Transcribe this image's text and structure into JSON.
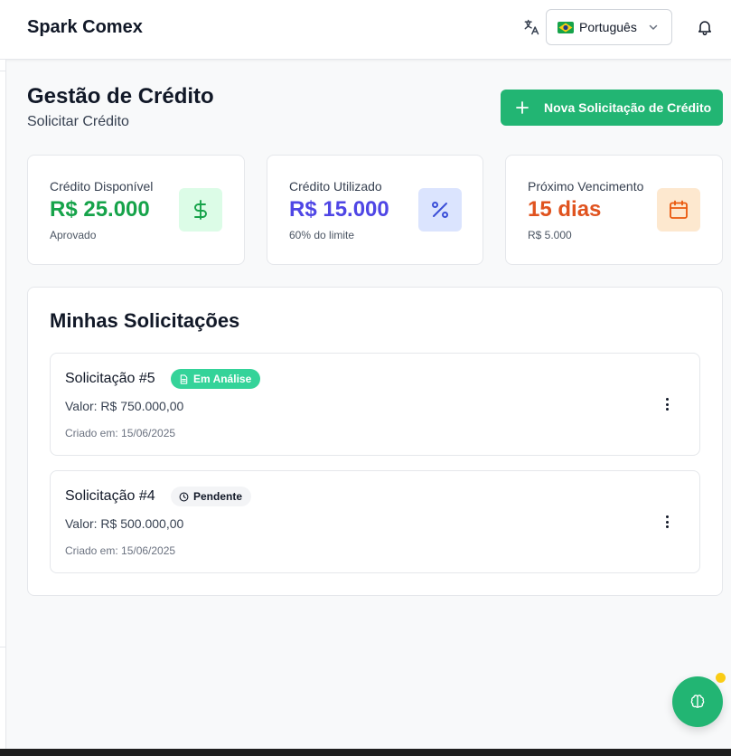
{
  "header": {
    "brand": "Spark Comex",
    "language": "Português",
    "language_icon": "translate-icon",
    "notifications_icon": "bell-icon"
  },
  "page": {
    "title": "Gestão de Crédito",
    "subtitle": "Solicitar Crédito",
    "new_request_label": "Nova Solicitação de Crédito"
  },
  "stats": [
    {
      "label": "Crédito Disponível",
      "value": "R$ 25.000",
      "sub": "Aprovado",
      "icon": "dollar-icon",
      "value_color": "#16a34a",
      "icon_bg": "#dcfce7",
      "icon_color": "#16a34a"
    },
    {
      "label": "Crédito Utilizado",
      "value": "R$ 15.000",
      "sub": "60% do limite",
      "icon": "percent-icon",
      "value_color": "#4f46e5",
      "icon_bg": "#dbe4fe",
      "icon_color": "#3b4fd8"
    },
    {
      "label": "Próximo Vencimento",
      "value": "15 dias",
      "sub": "R$ 5.000",
      "icon": "calendar-icon",
      "value_color": "#e0531f",
      "icon_bg": "#fde8cf",
      "icon_color": "#ea580c"
    }
  ],
  "requests": {
    "title": "Minhas Solicitações",
    "items": [
      {
        "title": "Solicitação #5",
        "status": "Em Análise",
        "status_icon": "document-icon",
        "status_bg": "#34d399",
        "status_color": "#ffffff",
        "value": "Valor: R$ 750.000,00",
        "created": "Criado em: 15/06/2025"
      },
      {
        "title": "Solicitação #4",
        "status": "Pendente",
        "status_icon": "clock-icon",
        "status_bg": "#f3f4f6",
        "status_color": "#111827",
        "value": "Valor: R$ 500.000,00",
        "created": "Criado em: 15/06/2025"
      }
    ]
  },
  "fab": {
    "icon": "brain-icon"
  },
  "colors": {
    "accent": "#22b573",
    "notification_dot": "#facc15"
  }
}
